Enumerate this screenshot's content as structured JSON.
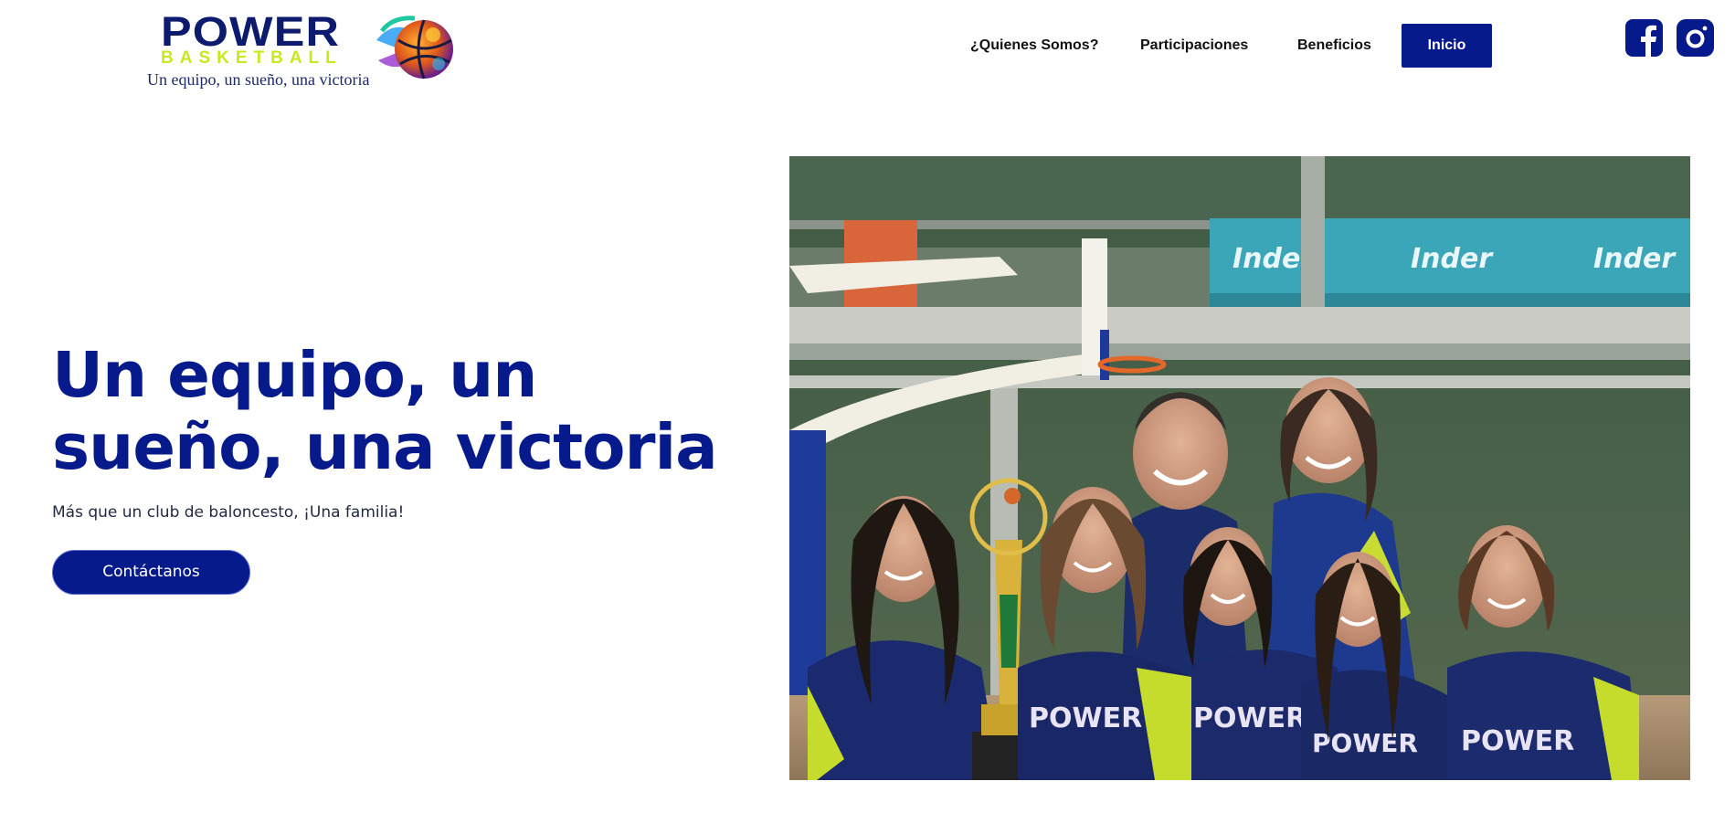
{
  "header": {
    "logo": {
      "word": "POWER",
      "subword": "BASKETBALL",
      "tagline": "Un equipo, un sueño, una victoria"
    },
    "nav": [
      {
        "label": "¿Quienes Somos?"
      },
      {
        "label": "Participaciones"
      },
      {
        "label": "Beneficios"
      },
      {
        "label": "Inicio",
        "active": true
      }
    ],
    "social": [
      {
        "icon": "facebook-icon"
      },
      {
        "icon": "instagram-icon"
      }
    ]
  },
  "hero": {
    "title": "Un equipo, un sueño, una victoria",
    "subtitle": "Más que un club de baloncesto, ¡Una familia!",
    "cta": "Contáctanos",
    "photo_banner_text": [
      "Inder",
      "Inder",
      "Inder"
    ],
    "jersey_text": "POWER"
  },
  "colors": {
    "brand_navy": "#061a8c",
    "brand_lime": "#c9e81f",
    "text_dark": "#111111"
  }
}
